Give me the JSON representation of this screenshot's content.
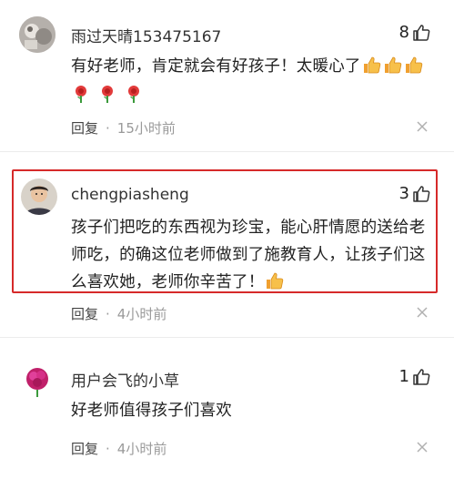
{
  "comments": [
    {
      "username": "雨过天晴153475167",
      "likes": "8",
      "text": "有好老师，肯定就会有好孩子！太暖心了",
      "reply_label": "回复",
      "separator": "·",
      "time": "15小时前",
      "emojis": [
        "thumbs-up",
        "thumbs-up",
        "thumbs-up",
        "rose",
        "rose",
        "rose"
      ]
    },
    {
      "username": "chengpiasheng",
      "likes": "3",
      "text": "孩子们把吃的东西视为珍宝，能心肝情愿的送给老师吃，的确这位老师做到了施教育人，让孩子们这么喜欢她，老师你辛苦了！",
      "reply_label": "回复",
      "separator": "·",
      "time": "4小时前",
      "emojis": [
        "thumbs-up"
      ],
      "highlighted": true,
      "highlight_color": "#d62a2a"
    },
    {
      "username": "用户会飞的小草",
      "likes": "1",
      "text": "好老师值得孩子们喜欢",
      "reply_label": "回复",
      "separator": "·",
      "time": "4小时前",
      "emojis": []
    }
  ],
  "colors": {
    "text": "#222222",
    "meta": "#9a9a9a",
    "divider": "#ececec",
    "highlight": "#d62a2a"
  }
}
